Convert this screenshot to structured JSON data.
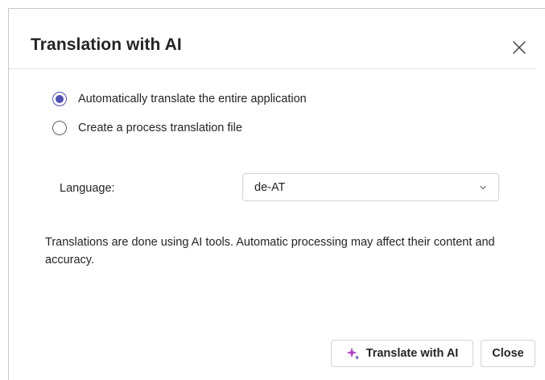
{
  "dialog": {
    "title": "Translation with AI",
    "close_icon": "close-icon"
  },
  "options": [
    {
      "label": "Automatically translate the entire application",
      "checked": true
    },
    {
      "label": "Create a process translation file",
      "checked": false
    }
  ],
  "language": {
    "label": "Language:",
    "selected": "de-AT",
    "icon": "chevron-down-icon"
  },
  "note": "Translations are done using AI tools. Automatic processing may affect their content and accuracy.",
  "buttons": {
    "translate_label": "Translate with AI",
    "translate_icon": "sparkle-icon",
    "close_label": "Close"
  },
  "colors": {
    "accent": "#4f52b2",
    "sparkle": "#b146c2"
  }
}
